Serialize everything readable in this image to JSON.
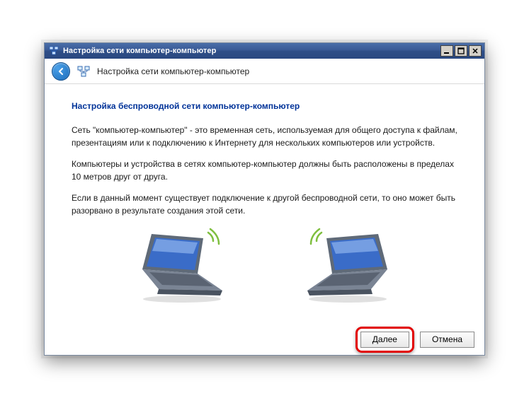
{
  "titlebar": {
    "title": "Настройка сети компьютер-компьютер"
  },
  "header": {
    "title": "Настройка сети компьютер-компьютер"
  },
  "content": {
    "heading": "Настройка беспроводной сети компьютер-компьютер",
    "p1": "Сеть \"компьютер-компьютер\" - это временная сеть, используемая для общего доступа к файлам, презентациям или к подключению к Интернету для нескольких компьютеров или устройств.",
    "p2": "Компьютеры и устройства в сетях компьютер-компьютер должны быть расположены в пределах 10 метров друг от друга.",
    "p3": "Если в данный момент существует подключение к другой беспроводной сети, то оно может быть разорвано в результате создания этой сети."
  },
  "footer": {
    "next": "Далее",
    "cancel": "Отмена"
  }
}
